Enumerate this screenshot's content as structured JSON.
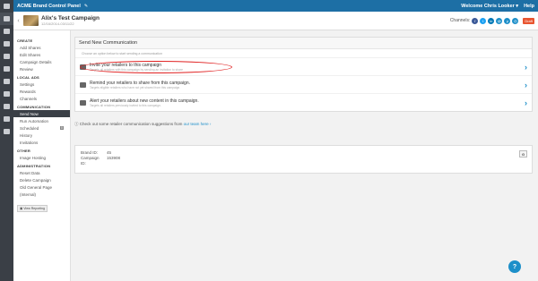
{
  "topbar": {
    "brand": "ACME Brand Control Panel",
    "pin": "✎",
    "user": "Welcome Chris Looker ▾",
    "help": "Help"
  },
  "campaign": {
    "title": "Alix's Test Campaign",
    "dates": "12/16/2014-03/11/22",
    "channels_label": "Channels:",
    "draft": "Draft"
  },
  "channels": [
    {
      "icon": "facebook-icon",
      "glyph": "f",
      "color": "#3b5998"
    },
    {
      "icon": "twitter-icon",
      "glyph": "t",
      "color": "#1da1f2"
    },
    {
      "icon": "linkedin-icon",
      "glyph": "in",
      "color": "#0077b5"
    },
    {
      "icon": "email-icon",
      "glyph": "@",
      "color": "#1d8fc9"
    },
    {
      "icon": "pinterest-icon",
      "glyph": "p",
      "color": "#1d8fc9"
    },
    {
      "icon": "instagram-icon",
      "glyph": "◎",
      "color": "#1d8fc9"
    }
  ],
  "nav": {
    "create": "CREATE",
    "add_shares": "Add Shares",
    "edit_shares": "Edit Shares",
    "campaign_details": "Campaign Details",
    "review": "Review",
    "local_ads": "LOCAL ADS",
    "settings": "Settings",
    "rewards": "Rewards",
    "channels": "Channels",
    "communication": "COMMUNICATION",
    "send_now": "Send Now",
    "run_automation": "Run Automation",
    "scheduled": "Scheduled",
    "scheduled_count": "0",
    "history": "History",
    "invitations": "Invitations",
    "other": "OTHER",
    "image_hosting": "Image Hosting",
    "administration": "ADMINISTRATION",
    "reset_data": "Reset Data",
    "delete_campaign": "Delete Campaign",
    "old_general_page": "Old General Page",
    "internal": "(Internal)",
    "view_reporting": "▣ View Reporting"
  },
  "main": {
    "header": "Send New Communication",
    "sub": "Choose an option below to start sending a communication",
    "options": [
      {
        "title": "Invite your retailers to this campaign",
        "desc": "Targets all retailers with this campaign by sending an invitation to share"
      },
      {
        "title": "Remind your retailers to share from this campaign.",
        "desc": "Targets eligible retailers who have not yet shared from this campaign."
      },
      {
        "title": "Alert your retailers about new content in this campaign.",
        "desc": "Targets all retailers previously invited to this campaign."
      }
    ],
    "suggest_prefix": "Check out some retailer communication suggestions from ",
    "suggest_link": "our team here ›",
    "brand_id_label": "Brand ID:",
    "brand_id": "45",
    "campaign_id_label": "Campaign ID:",
    "campaign_id": "153908",
    "g_button": "G"
  },
  "help_button": "?"
}
